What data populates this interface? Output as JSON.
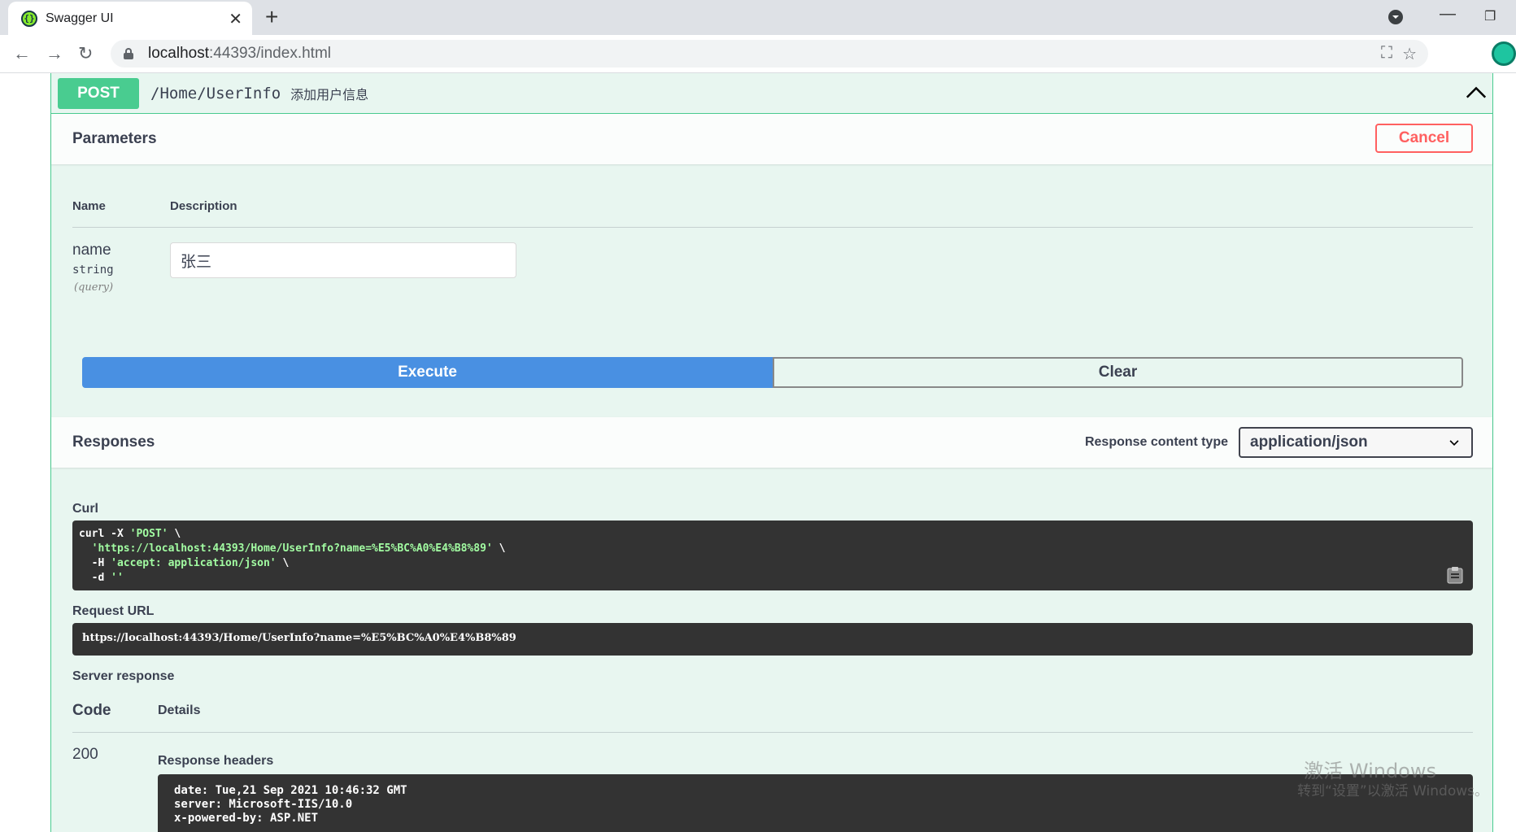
{
  "browser": {
    "tab_title": "Swagger UI",
    "url_host": "localhost",
    "url_path": ":44393/index.html"
  },
  "operation": {
    "method": "POST",
    "path": "/Home/UserInfo",
    "description": "添加用户信息"
  },
  "parameters": {
    "title": "Parameters",
    "cancel_label": "Cancel",
    "col_name": "Name",
    "col_description": "Description",
    "items": [
      {
        "name": "name",
        "type": "string",
        "in": "(query)",
        "value": "张三"
      }
    ]
  },
  "actions": {
    "execute_label": "Execute",
    "clear_label": "Clear"
  },
  "responses": {
    "title": "Responses",
    "content_type_label": "Response content type",
    "content_type_value": "application/json",
    "curl_label": "Curl",
    "curl": {
      "line1_cmd": "curl -X ",
      "line1_method": "'POST'",
      "line1_end": " \\",
      "line2_url": "'https://localhost:44393/Home/UserInfo?name=%E5%BC%A0%E4%B8%89'",
      "line2_end": " \\",
      "line3_flag": "  -H ",
      "line3_header": "'accept: application/json'",
      "line3_end": " \\",
      "line4_flag": "  -d ",
      "line4_data": "''"
    },
    "request_url_label": "Request URL",
    "request_url": "https://localhost:44393/Home/UserInfo?name=%E5%BC%A0%E4%B8%89",
    "server_response_label": "Server response",
    "col_code": "Code",
    "col_details": "Details",
    "code": "200",
    "response_headers_label": "Response headers",
    "headers": [
      "date: Tue,21 Sep 2021 10:46:32 GMT",
      "server: Microsoft-IIS/10.0",
      "x-powered-by: ASP.NET"
    ]
  },
  "watermark": {
    "line1": "激活 Windows",
    "line2": "转到“设置”以激活 Windows。"
  }
}
